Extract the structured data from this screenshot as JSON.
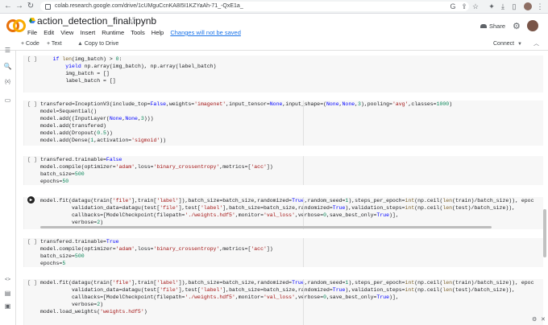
{
  "browser": {
    "url": "colab.research.google.com/drive/1cUMguCcnKA8I5I1KZYaAh-71_-QxE1a_",
    "nav": {
      "back": "←",
      "forward": "→",
      "reload": "↻"
    },
    "right_icons": [
      "G",
      "⇪",
      "☆",
      "✦",
      "⤓",
      "▯",
      "⋮"
    ]
  },
  "header": {
    "title": "action_detection_final.ipynb",
    "star": "☆",
    "menu": [
      "File",
      "Edit",
      "View",
      "Insert",
      "Runtime",
      "Tools",
      "Help"
    ],
    "unsaved": "Changes will not be saved",
    "share": "Share",
    "gear": "⚙",
    "brand_colors": {
      "orange": "#f9ab00",
      "amber": "#e8710a"
    }
  },
  "toolbar": {
    "code": "+ Code",
    "text": "+ Text",
    "copy_to_drive": "Copy to Drive",
    "connect": "Connect",
    "caret": "▼",
    "collapse": "︿"
  },
  "rail": [
    "☰",
    "🔍",
    "{x}",
    "▭",
    "<>",
    "▤",
    "▣"
  ],
  "cells": [
    {
      "run": "[ ]"
    },
    {
      "run": "[ ]"
    },
    {
      "run": "[ ]"
    },
    {
      "run": "▶"
    },
    {
      "run": "[ ]"
    },
    {
      "run": "[ ]"
    }
  ],
  "corner_icons": [
    "⚙",
    "✕"
  ]
}
